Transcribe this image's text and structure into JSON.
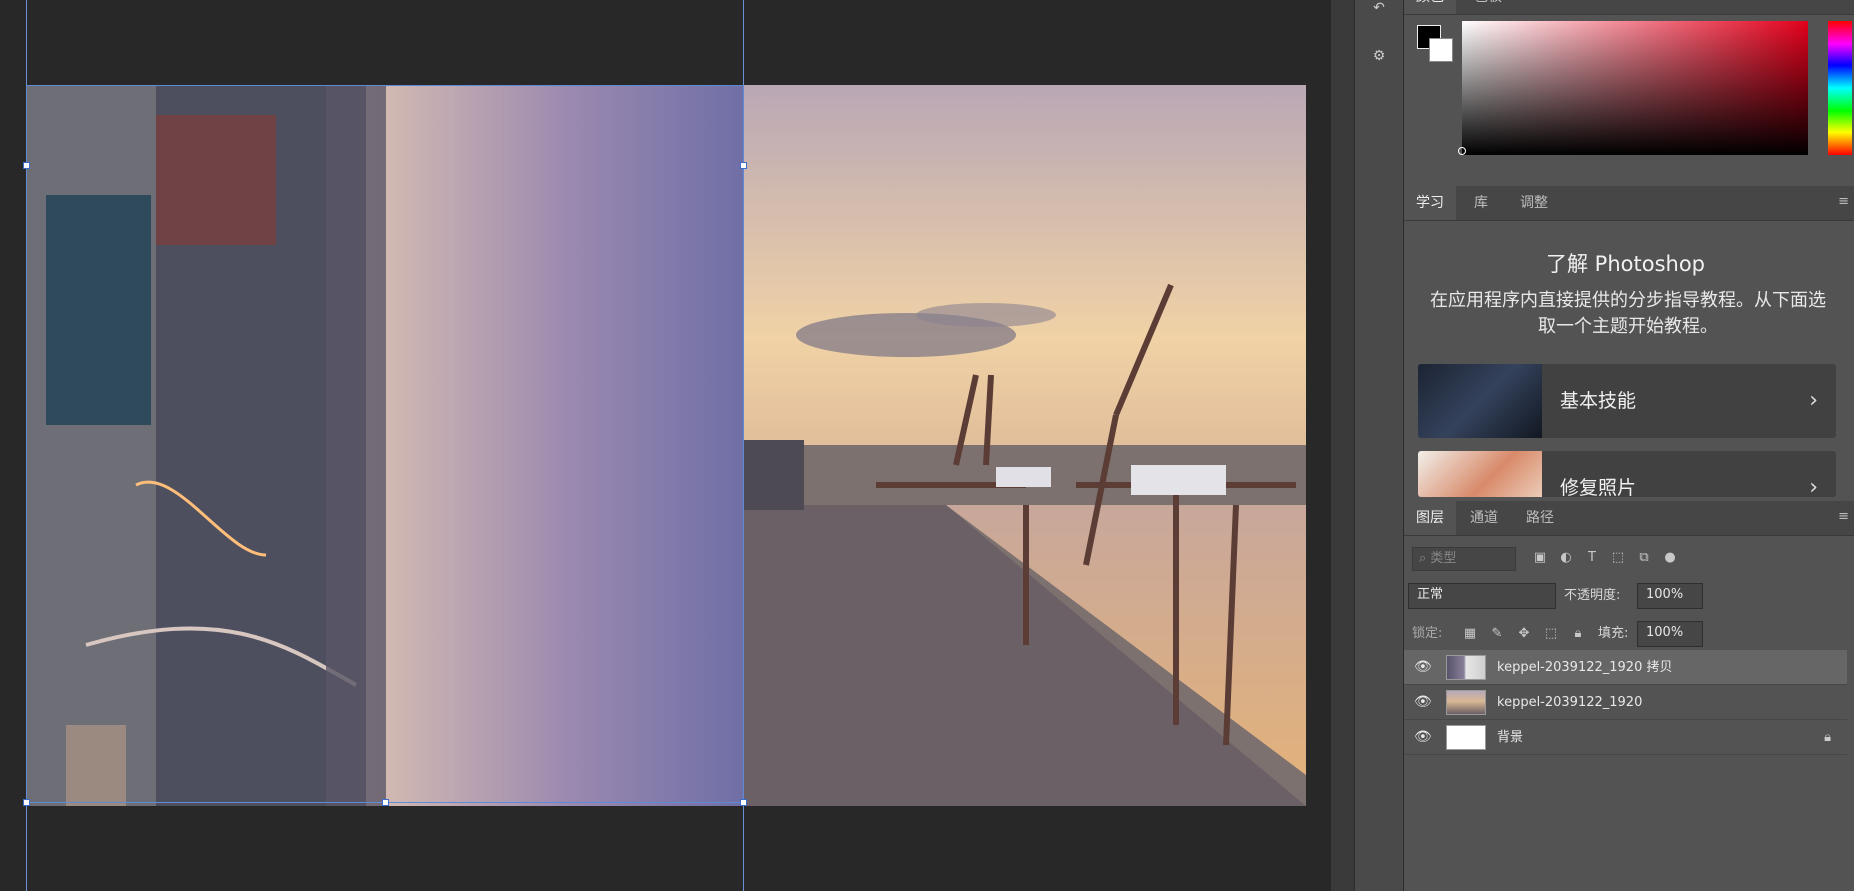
{
  "color_panel": {
    "tabs": [
      {
        "label": "颜色",
        "active": true
      },
      {
        "label": "色板",
        "active": false
      }
    ],
    "foreground_color": "#000000",
    "background_color": "#ffffff",
    "hue_color": "#e3001b"
  },
  "learn_panel": {
    "tabs": [
      {
        "label": "学习",
        "active": true
      },
      {
        "label": "库",
        "active": false
      },
      {
        "label": "调整",
        "active": false
      }
    ],
    "title": "了解 Photoshop",
    "description": "在应用程序内直接提供的分步指导教程。从下面选取一个主题开始教程。",
    "cards": [
      {
        "label": "基本技能",
        "icon": "chevron-right-icon"
      },
      {
        "label": "修复照片",
        "icon": "chevron-right-icon"
      }
    ]
  },
  "layers_panel": {
    "tabs": [
      {
        "label": "图层",
        "active": true
      },
      {
        "label": "通道",
        "active": false
      },
      {
        "label": "路径",
        "active": false
      }
    ],
    "filter_placeholder": "类型",
    "filter_icons": [
      "image-icon",
      "adjustment-icon",
      "type-icon",
      "shape-icon",
      "smart-object-icon",
      "toggle-dot-icon"
    ],
    "blend_mode": "正常",
    "opacity_label": "不透明度:",
    "opacity_value": "100%",
    "lock_label": "锁定:",
    "lock_icons": [
      "lock-transparent-icon",
      "lock-paint-icon",
      "lock-move-icon",
      "lock-artboard-icon",
      "lock-all-icon"
    ],
    "fill_label": "填充:",
    "fill_value": "100%",
    "layers": [
      {
        "name": "keppel-2039122_1920 拷贝",
        "visible": true,
        "selected": true
      },
      {
        "name": "keppel-2039122_1920",
        "visible": true,
        "selected": false
      },
      {
        "name": "背景",
        "visible": true,
        "selected": false,
        "locked": true
      }
    ]
  },
  "accent_color": "#5e8ad6"
}
